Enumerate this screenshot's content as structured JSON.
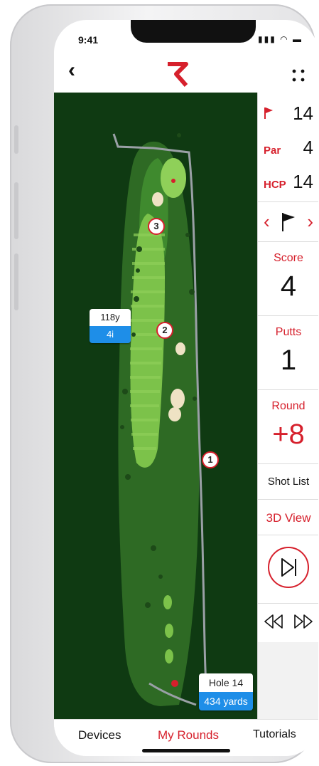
{
  "status": {
    "time": "9:41"
  },
  "map": {
    "shots": [
      "3",
      "2",
      "1"
    ],
    "distance_card": {
      "yards": "118y",
      "club": "4i"
    },
    "hole_card": {
      "hole": "Hole 14",
      "length": "434 yards"
    }
  },
  "panel": {
    "hole_number": "14",
    "par_label": "Par",
    "par_value": "4",
    "hcp_label": "HCP",
    "hcp_value": "14",
    "score_label": "Score",
    "score_value": "4",
    "putts_label": "Putts",
    "putts_value": "1",
    "round_label": "Round",
    "round_value": "+8",
    "shot_list_label": "Shot List",
    "view_3d_label": "3D View"
  },
  "tabs": [
    "Devices",
    "My Rounds",
    "Tutorials"
  ],
  "colors": {
    "accent": "#d6202c",
    "fairway": "#7cc24a",
    "rough": "#2e6a24",
    "out_of_bounds": "#0f3a12",
    "info_blue": "#1e8ee8"
  }
}
